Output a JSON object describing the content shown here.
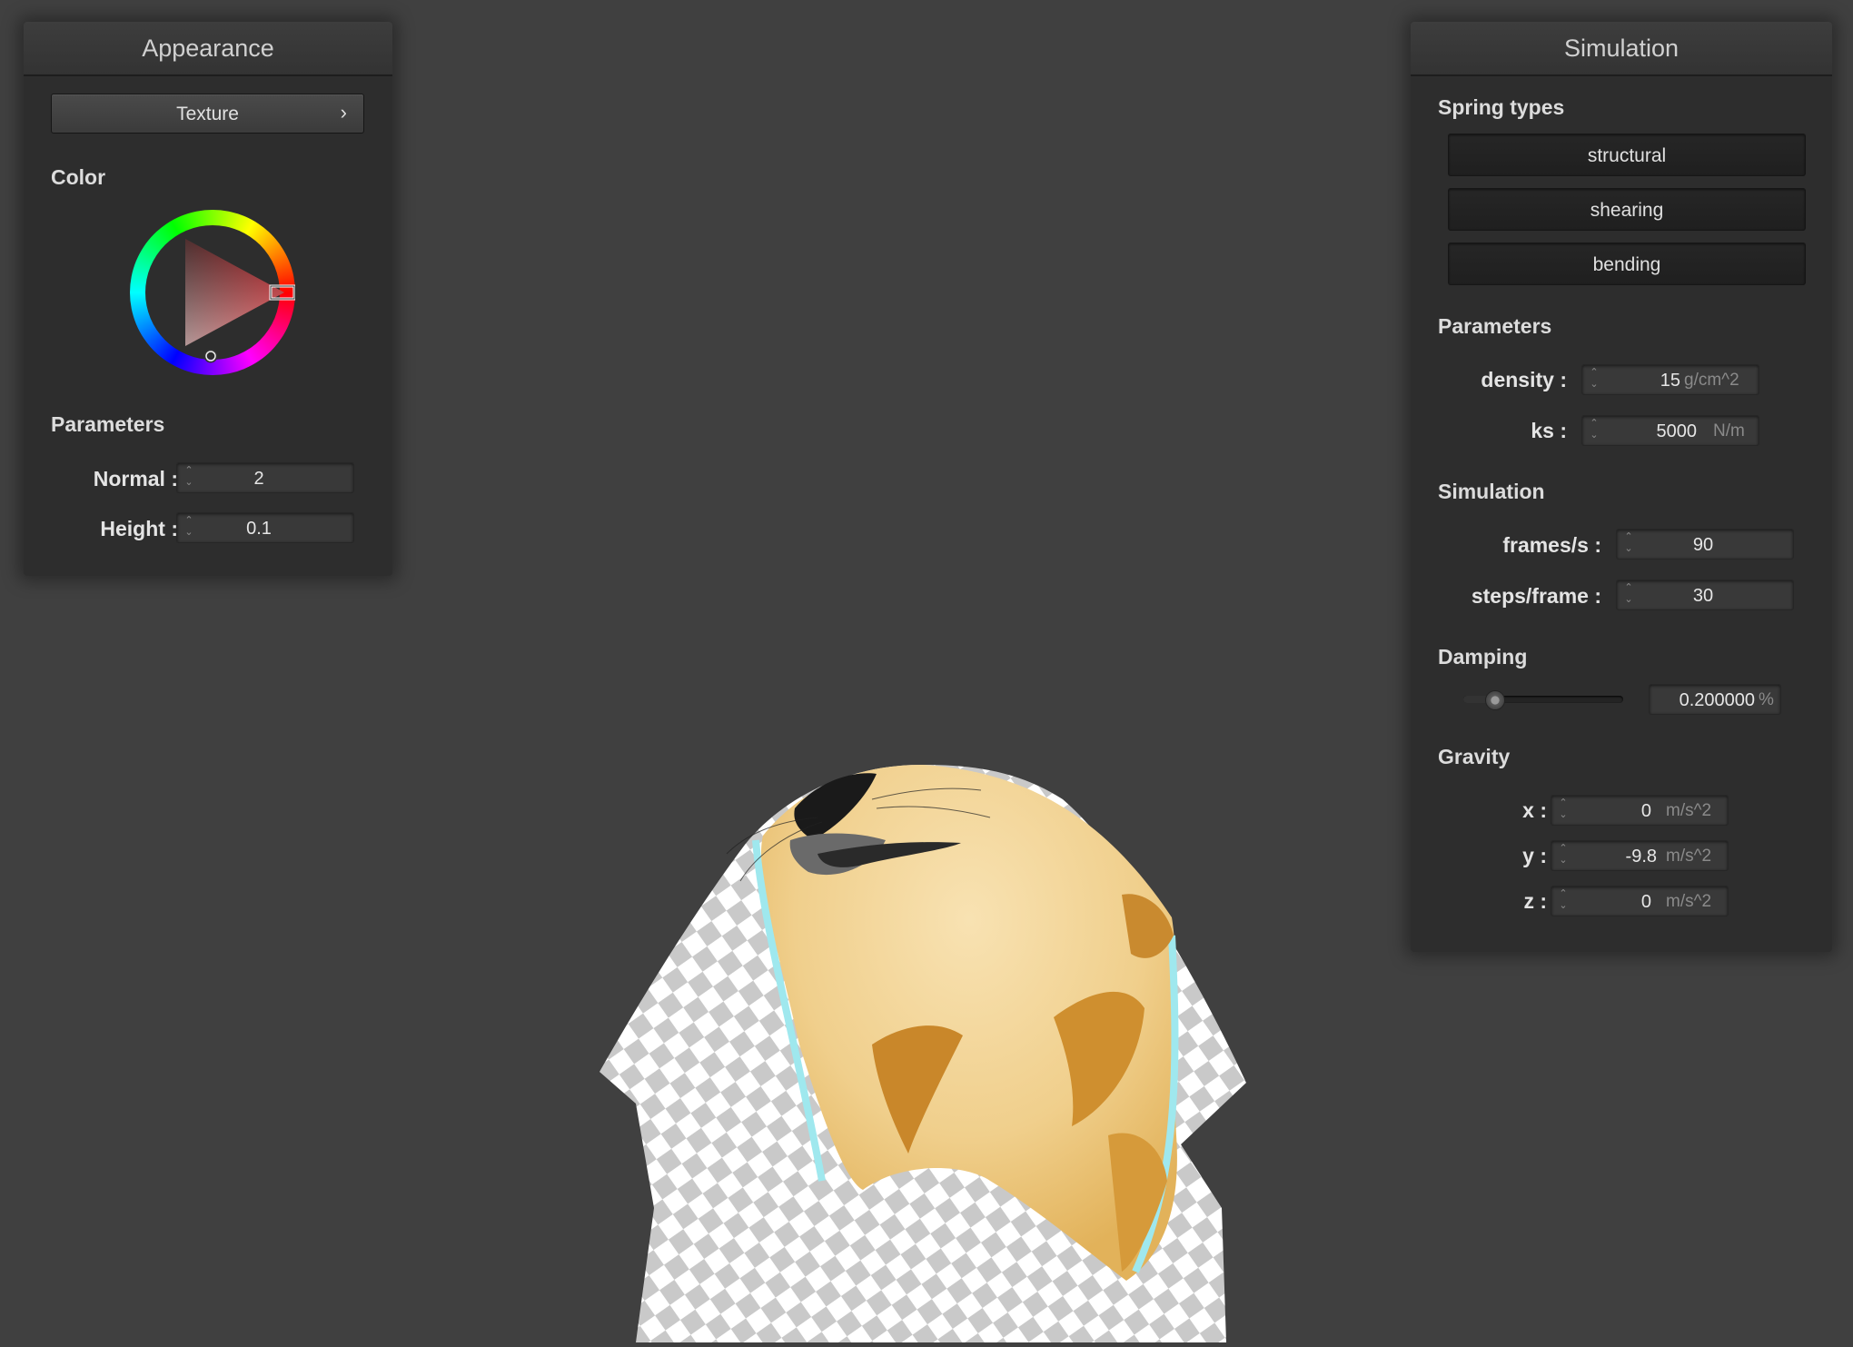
{
  "appearance": {
    "title": "Appearance",
    "texture_button": "Texture",
    "texture_chevron": "›",
    "color_label": "Color",
    "color_wheel": {
      "selected_hue_color": "#e8252b",
      "hue_marker": "red"
    },
    "parameters_label": "Parameters",
    "normal": {
      "label": "Normal :",
      "value": "2"
    },
    "height": {
      "label": "Height :",
      "value": "0.1"
    }
  },
  "simulation": {
    "title": "Simulation",
    "spring_types_label": "Spring types",
    "spring_buttons": [
      "structural",
      "shearing",
      "bending"
    ],
    "parameters_label": "Parameters",
    "density": {
      "label": "density :",
      "value": "15",
      "unit": "g/cm^2"
    },
    "ks": {
      "label": "ks :",
      "value": "5000",
      "unit": "N/m"
    },
    "simulation_label": "Simulation",
    "fps": {
      "label": "frames/s :",
      "value": "90"
    },
    "steps": {
      "label": "steps/frame :",
      "value": "30"
    },
    "damping_label": "Damping",
    "damping": {
      "value": "0.200000",
      "unit": "%",
      "slider_fraction": 0.2
    },
    "gravity_label": "Gravity",
    "gx": {
      "label": "x :",
      "value": "0",
      "unit": "m/s^2"
    },
    "gy": {
      "label": "y :",
      "value": "-9.8",
      "unit": "m/s^2"
    },
    "gz": {
      "label": "z :",
      "value": "0",
      "unit": "m/s^2"
    }
  },
  "scene": {
    "object": "cloth",
    "texture": "seal-face-checkerboard",
    "background_color": "#404040"
  }
}
